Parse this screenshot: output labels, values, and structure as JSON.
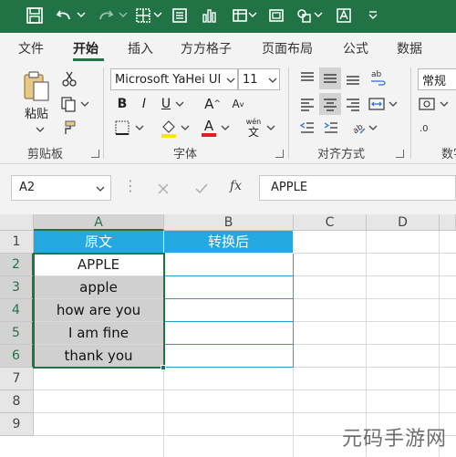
{
  "ribbon_tabs": [
    "文件",
    "开始",
    "插入",
    "方方格子",
    "页面布局",
    "公式",
    "数据"
  ],
  "active_tab": "开始",
  "clipboard": {
    "paste_label": "粘贴",
    "group_label": "剪贴板"
  },
  "font": {
    "family": "Microsoft YaHei UI",
    "size": "11",
    "group_label": "字体",
    "bold": "B",
    "italic": "I",
    "underline": "U",
    "grow": "A",
    "shrink": "A",
    "color_a": "A",
    "wen": "wén",
    "wen_char": "文"
  },
  "alignment": {
    "group_label": "对齐方式"
  },
  "number": {
    "format": "常规",
    "group_label": "数字"
  },
  "formula_bar": {
    "name_box": "A2",
    "fx": "fx",
    "content": "APPLE"
  },
  "columns": [
    "A",
    "B",
    "C",
    "D"
  ],
  "rows": [
    "1",
    "2",
    "3",
    "4",
    "5",
    "6",
    "7",
    "8",
    "9"
  ],
  "sheet": {
    "header_a": "原文",
    "header_b": "转换后",
    "values": [
      "APPLE",
      "apple",
      "how are you",
      "I am fine",
      "thank you"
    ]
  },
  "colors": {
    "excel_green": "#217346",
    "header_blue": "#23a8e0",
    "selection_grey": "#d0d0d0"
  },
  "watermark": "元码手游网"
}
